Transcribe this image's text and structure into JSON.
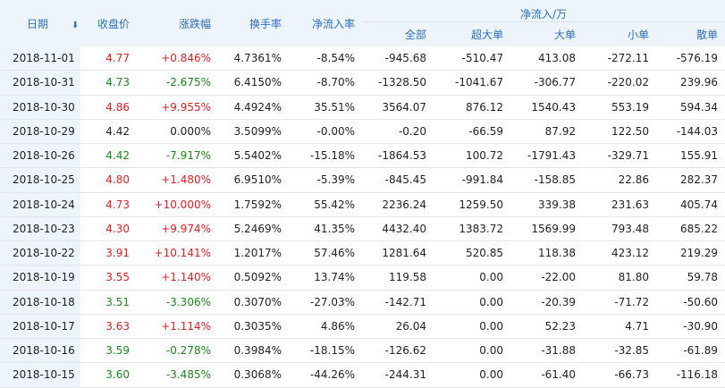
{
  "header": {
    "date": "日期",
    "close": "收盘价",
    "change": "涨跌幅",
    "turnover": "换手率",
    "net_ratio": "净流入率",
    "net_group": "净流入/万",
    "sub": [
      "全部",
      "超大单",
      "大单",
      "小单",
      "散单"
    ]
  },
  "colors": {
    "up": "#e02020",
    "down": "#178a17",
    "header_bg": "#eef4fb",
    "header_text": "#2a6fc0"
  },
  "rows": [
    {
      "date": "2018-11-01",
      "close": "4.77",
      "change": "+0.846%",
      "turnover": "4.7361%",
      "net_ratio": "-8.54%",
      "total": "-945.68",
      "xl": "-510.47",
      "l": "413.08",
      "s": "-272.11",
      "xs": "-576.19",
      "dir": "up"
    },
    {
      "date": "2018-10-31",
      "close": "4.73",
      "change": "-2.675%",
      "turnover": "6.4150%",
      "net_ratio": "-8.70%",
      "total": "-1328.50",
      "xl": "-1041.67",
      "l": "-306.77",
      "s": "-220.02",
      "xs": "239.96",
      "dir": "down"
    },
    {
      "date": "2018-10-30",
      "close": "4.86",
      "change": "+9.955%",
      "turnover": "4.4924%",
      "net_ratio": "35.51%",
      "total": "3564.07",
      "xl": "876.12",
      "l": "1540.43",
      "s": "553.19",
      "xs": "594.34",
      "dir": "up"
    },
    {
      "date": "2018-10-29",
      "close": "4.42",
      "change": "0.000%",
      "turnover": "3.5099%",
      "net_ratio": "-0.00%",
      "total": "-0.20",
      "xl": "-66.59",
      "l": "87.92",
      "s": "122.50",
      "xs": "-144.03",
      "dir": "flat"
    },
    {
      "date": "2018-10-26",
      "close": "4.42",
      "change": "-7.917%",
      "turnover": "5.5402%",
      "net_ratio": "-15.18%",
      "total": "-1864.53",
      "xl": "100.72",
      "l": "-1791.43",
      "s": "-329.71",
      "xs": "155.91",
      "dir": "down"
    },
    {
      "date": "2018-10-25",
      "close": "4.80",
      "change": "+1.480%",
      "turnover": "6.9510%",
      "net_ratio": "-5.39%",
      "total": "-845.45",
      "xl": "-991.84",
      "l": "-158.85",
      "s": "22.86",
      "xs": "282.37",
      "dir": "up"
    },
    {
      "date": "2018-10-24",
      "close": "4.73",
      "change": "+10.000%",
      "turnover": "1.7592%",
      "net_ratio": "55.42%",
      "total": "2236.24",
      "xl": "1259.50",
      "l": "339.38",
      "s": "231.63",
      "xs": "405.74",
      "dir": "up"
    },
    {
      "date": "2018-10-23",
      "close": "4.30",
      "change": "+9.974%",
      "turnover": "5.2469%",
      "net_ratio": "41.35%",
      "total": "4432.40",
      "xl": "1383.72",
      "l": "1569.99",
      "s": "793.48",
      "xs": "685.22",
      "dir": "up"
    },
    {
      "date": "2018-10-22",
      "close": "3.91",
      "change": "+10.141%",
      "turnover": "1.2017%",
      "net_ratio": "57.46%",
      "total": "1281.64",
      "xl": "520.85",
      "l": "118.38",
      "s": "423.12",
      "xs": "219.29",
      "dir": "up"
    },
    {
      "date": "2018-10-19",
      "close": "3.55",
      "change": "+1.140%",
      "turnover": "0.5092%",
      "net_ratio": "13.74%",
      "total": "119.58",
      "xl": "0.00",
      "l": "-22.00",
      "s": "81.80",
      "xs": "59.78",
      "dir": "up"
    },
    {
      "date": "2018-10-18",
      "close": "3.51",
      "change": "-3.306%",
      "turnover": "0.3070%",
      "net_ratio": "-27.03%",
      "total": "-142.71",
      "xl": "0.00",
      "l": "-20.39",
      "s": "-71.72",
      "xs": "-50.60",
      "dir": "down"
    },
    {
      "date": "2018-10-17",
      "close": "3.63",
      "change": "+1.114%",
      "turnover": "0.3035%",
      "net_ratio": "4.86%",
      "total": "26.04",
      "xl": "0.00",
      "l": "52.23",
      "s": "4.71",
      "xs": "-30.90",
      "dir": "up"
    },
    {
      "date": "2018-10-16",
      "close": "3.59",
      "change": "-0.278%",
      "turnover": "0.3984%",
      "net_ratio": "-18.15%",
      "total": "-126.62",
      "xl": "0.00",
      "l": "-31.88",
      "s": "-32.85",
      "xs": "-61.89",
      "dir": "down"
    },
    {
      "date": "2018-10-15",
      "close": "3.60",
      "change": "-3.485%",
      "turnover": "0.3068%",
      "net_ratio": "-44.26%",
      "total": "-244.31",
      "xl": "0.00",
      "l": "-61.40",
      "s": "-66.73",
      "xs": "-116.18",
      "dir": "down"
    }
  ]
}
